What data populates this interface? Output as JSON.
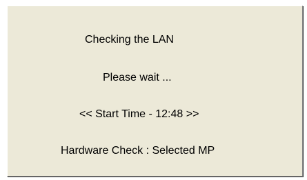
{
  "dialog": {
    "status_line": "Checking the LAN",
    "wait_line": "Please wait ...",
    "start_time_line": "<< Start Time - 12:48  >>",
    "hardware_check_line": "Hardware Check : Selected MP"
  },
  "colors": {
    "dialog_background": "#ece9d8",
    "text": "#000000"
  }
}
